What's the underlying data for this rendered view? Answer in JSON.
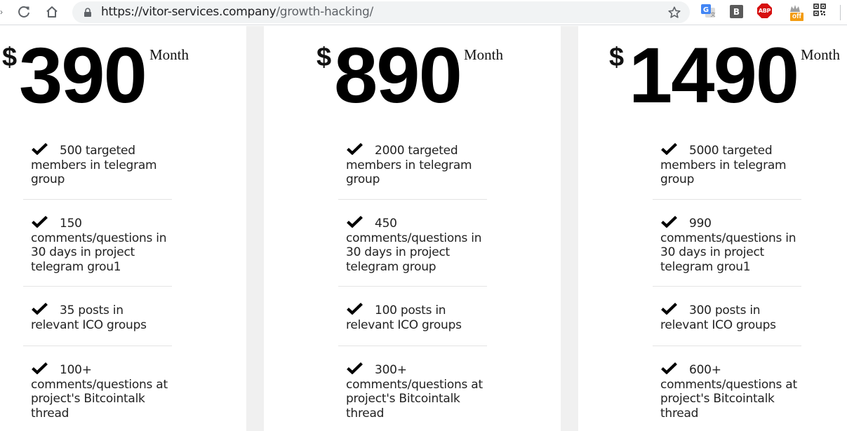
{
  "browser": {
    "url_host": "https://vitor-services.company",
    "url_path": "/growth-hacking/",
    "buttons": [
      "reload-icon",
      "home-icon",
      "star-icon"
    ],
    "extensions": [
      {
        "name": "google-translate-icon"
      },
      {
        "name": "b-extension-icon",
        "label": "B"
      },
      {
        "name": "adblock-plus-icon",
        "label": "ABP"
      },
      {
        "name": "off-extension-icon",
        "label": "off"
      },
      {
        "name": "qr-code-icon"
      }
    ]
  },
  "pricing": {
    "plans": [
      {
        "currency": "$",
        "amount": "390",
        "period": "Month",
        "features": [
          "500 targeted members in telegram group",
          "150 comments/questions in 30 days in project telegram grou1",
          "35 posts in relevant ICO groups",
          "100+ comments/questions at project's Bitcointalk thread"
        ]
      },
      {
        "currency": "$",
        "amount": "890",
        "period": "Month",
        "features": [
          "2000 targeted members in telegram group",
          "450 comments/questions in 30 days in project telegram group",
          "100 posts in relevant ICO groups",
          "300+ comments/questions at project's Bitcointalk thread"
        ]
      },
      {
        "currency": "$",
        "amount": "1490",
        "period": "Month",
        "features": [
          "5000 targeted members in telegram group",
          "990 comments/questions in 30 days in project telegram grou1",
          "300 posts in relevant ICO groups",
          "600+ comments/questions at project's Bitcointalk thread"
        ]
      }
    ]
  },
  "colors": {
    "text": "#000000",
    "divider": "#e4e4e4",
    "column_gap": "#f0f0f0",
    "toolbar_bg": "#ffffff",
    "omnibox_bg": "#f1f3f4"
  }
}
